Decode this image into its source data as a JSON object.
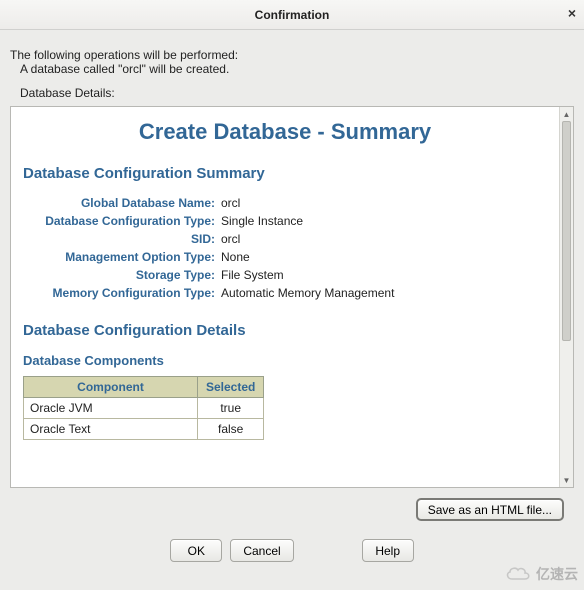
{
  "window": {
    "title": "Confirmation",
    "close_label": "×"
  },
  "intro": {
    "line1": "The following operations will be performed:",
    "line2": "A database called \"orcl\" will be created.",
    "details_label": "Database Details:"
  },
  "summary": {
    "heading": "Create Database - Summary",
    "section_title": "Database Configuration Summary",
    "rows": [
      {
        "label": "Global Database Name:",
        "value": "orcl"
      },
      {
        "label": "Database Configuration Type:",
        "value": "Single Instance"
      },
      {
        "label": "SID:",
        "value": "orcl"
      },
      {
        "label": "Management Option Type:",
        "value": "None"
      },
      {
        "label": "Storage Type:",
        "value": "File System"
      },
      {
        "label": "Memory Configuration Type:",
        "value": "Automatic Memory Management"
      }
    ]
  },
  "details": {
    "section_title": "Database Configuration Details",
    "components_title": "Database Components",
    "columns": {
      "component": "Component",
      "selected": "Selected"
    },
    "rows": [
      {
        "component": "Oracle JVM",
        "selected": "true"
      },
      {
        "component": "Oracle Text",
        "selected": "false"
      }
    ]
  },
  "buttons": {
    "save_html": "Save as an HTML file...",
    "ok": "OK",
    "cancel": "Cancel",
    "help": "Help"
  },
  "watermark": "亿速云"
}
